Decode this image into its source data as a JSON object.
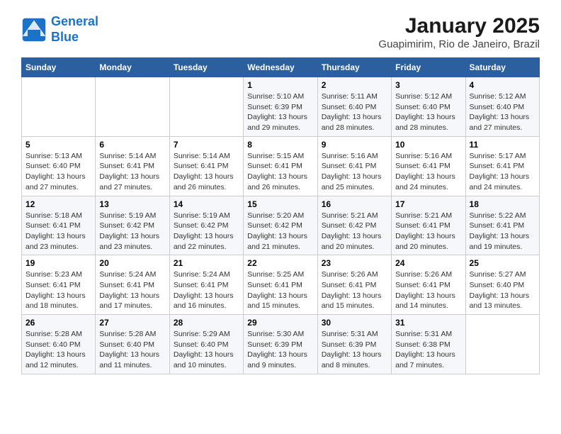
{
  "header": {
    "logo_line1": "General",
    "logo_line2": "Blue",
    "title": "January 2025",
    "subtitle": "Guapimirim, Rio de Janeiro, Brazil"
  },
  "weekdays": [
    "Sunday",
    "Monday",
    "Tuesday",
    "Wednesday",
    "Thursday",
    "Friday",
    "Saturday"
  ],
  "weeks": [
    [
      {
        "day": "",
        "detail": ""
      },
      {
        "day": "",
        "detail": ""
      },
      {
        "day": "",
        "detail": ""
      },
      {
        "day": "1",
        "detail": "Sunrise: 5:10 AM\nSunset: 6:39 PM\nDaylight: 13 hours and 29 minutes."
      },
      {
        "day": "2",
        "detail": "Sunrise: 5:11 AM\nSunset: 6:40 PM\nDaylight: 13 hours and 28 minutes."
      },
      {
        "day": "3",
        "detail": "Sunrise: 5:12 AM\nSunset: 6:40 PM\nDaylight: 13 hours and 28 minutes."
      },
      {
        "day": "4",
        "detail": "Sunrise: 5:12 AM\nSunset: 6:40 PM\nDaylight: 13 hours and 27 minutes."
      }
    ],
    [
      {
        "day": "5",
        "detail": "Sunrise: 5:13 AM\nSunset: 6:40 PM\nDaylight: 13 hours and 27 minutes."
      },
      {
        "day": "6",
        "detail": "Sunrise: 5:14 AM\nSunset: 6:41 PM\nDaylight: 13 hours and 27 minutes."
      },
      {
        "day": "7",
        "detail": "Sunrise: 5:14 AM\nSunset: 6:41 PM\nDaylight: 13 hours and 26 minutes."
      },
      {
        "day": "8",
        "detail": "Sunrise: 5:15 AM\nSunset: 6:41 PM\nDaylight: 13 hours and 26 minutes."
      },
      {
        "day": "9",
        "detail": "Sunrise: 5:16 AM\nSunset: 6:41 PM\nDaylight: 13 hours and 25 minutes."
      },
      {
        "day": "10",
        "detail": "Sunrise: 5:16 AM\nSunset: 6:41 PM\nDaylight: 13 hours and 24 minutes."
      },
      {
        "day": "11",
        "detail": "Sunrise: 5:17 AM\nSunset: 6:41 PM\nDaylight: 13 hours and 24 minutes."
      }
    ],
    [
      {
        "day": "12",
        "detail": "Sunrise: 5:18 AM\nSunset: 6:41 PM\nDaylight: 13 hours and 23 minutes."
      },
      {
        "day": "13",
        "detail": "Sunrise: 5:19 AM\nSunset: 6:42 PM\nDaylight: 13 hours and 23 minutes."
      },
      {
        "day": "14",
        "detail": "Sunrise: 5:19 AM\nSunset: 6:42 PM\nDaylight: 13 hours and 22 minutes."
      },
      {
        "day": "15",
        "detail": "Sunrise: 5:20 AM\nSunset: 6:42 PM\nDaylight: 13 hours and 21 minutes."
      },
      {
        "day": "16",
        "detail": "Sunrise: 5:21 AM\nSunset: 6:42 PM\nDaylight: 13 hours and 20 minutes."
      },
      {
        "day": "17",
        "detail": "Sunrise: 5:21 AM\nSunset: 6:41 PM\nDaylight: 13 hours and 20 minutes."
      },
      {
        "day": "18",
        "detail": "Sunrise: 5:22 AM\nSunset: 6:41 PM\nDaylight: 13 hours and 19 minutes."
      }
    ],
    [
      {
        "day": "19",
        "detail": "Sunrise: 5:23 AM\nSunset: 6:41 PM\nDaylight: 13 hours and 18 minutes."
      },
      {
        "day": "20",
        "detail": "Sunrise: 5:24 AM\nSunset: 6:41 PM\nDaylight: 13 hours and 17 minutes."
      },
      {
        "day": "21",
        "detail": "Sunrise: 5:24 AM\nSunset: 6:41 PM\nDaylight: 13 hours and 16 minutes."
      },
      {
        "day": "22",
        "detail": "Sunrise: 5:25 AM\nSunset: 6:41 PM\nDaylight: 13 hours and 15 minutes."
      },
      {
        "day": "23",
        "detail": "Sunrise: 5:26 AM\nSunset: 6:41 PM\nDaylight: 13 hours and 15 minutes."
      },
      {
        "day": "24",
        "detail": "Sunrise: 5:26 AM\nSunset: 6:41 PM\nDaylight: 13 hours and 14 minutes."
      },
      {
        "day": "25",
        "detail": "Sunrise: 5:27 AM\nSunset: 6:40 PM\nDaylight: 13 hours and 13 minutes."
      }
    ],
    [
      {
        "day": "26",
        "detail": "Sunrise: 5:28 AM\nSunset: 6:40 PM\nDaylight: 13 hours and 12 minutes."
      },
      {
        "day": "27",
        "detail": "Sunrise: 5:28 AM\nSunset: 6:40 PM\nDaylight: 13 hours and 11 minutes."
      },
      {
        "day": "28",
        "detail": "Sunrise: 5:29 AM\nSunset: 6:40 PM\nDaylight: 13 hours and 10 minutes."
      },
      {
        "day": "29",
        "detail": "Sunrise: 5:30 AM\nSunset: 6:39 PM\nDaylight: 13 hours and 9 minutes."
      },
      {
        "day": "30",
        "detail": "Sunrise: 5:31 AM\nSunset: 6:39 PM\nDaylight: 13 hours and 8 minutes."
      },
      {
        "day": "31",
        "detail": "Sunrise: 5:31 AM\nSunset: 6:38 PM\nDaylight: 13 hours and 7 minutes."
      },
      {
        "day": "",
        "detail": ""
      }
    ]
  ]
}
